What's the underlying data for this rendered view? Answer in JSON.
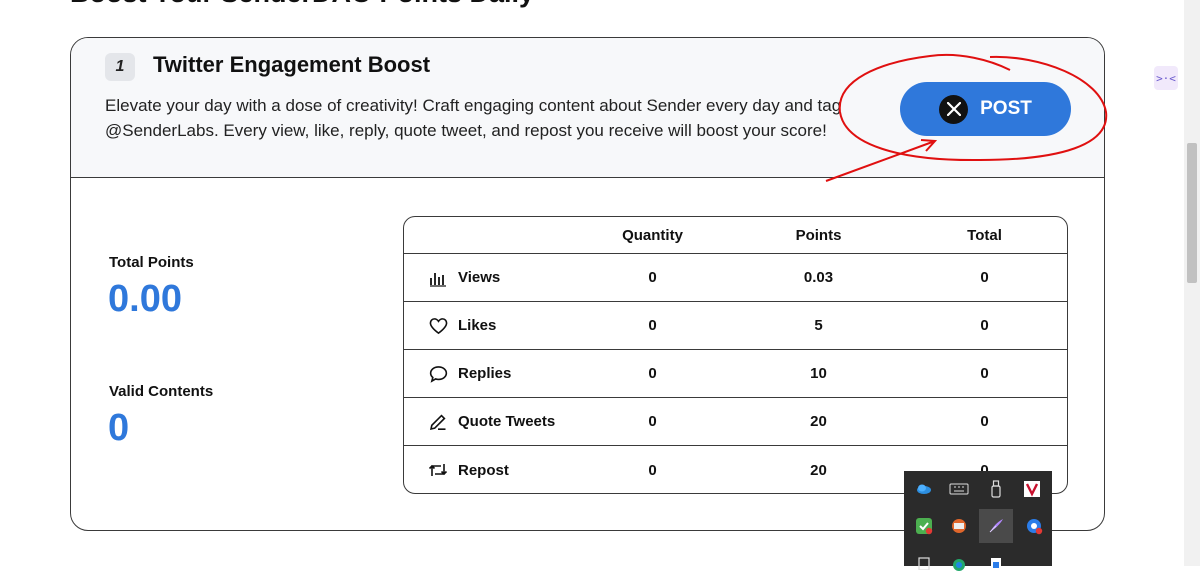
{
  "page": {
    "heading": "Boost Your SenderDAO Points Daily"
  },
  "task": {
    "step_number": "1",
    "title": "Twitter Engagement Boost",
    "description": "Elevate your day with a dose of creativity! Craft engaging content about Sender every day and tag @SenderLabs. Every view, like, reply, quote tweet, and repost you receive will boost your score!",
    "post_button_label": "POST"
  },
  "stats": {
    "total_points_label": "Total Points",
    "total_points_value": "0.00",
    "valid_contents_label": "Valid Contents",
    "valid_contents_value": "0"
  },
  "table": {
    "headers": [
      "Quantity",
      "Points",
      "Total"
    ],
    "rows": [
      {
        "icon": "bar-chart-icon",
        "name": "Views",
        "quantity": "0",
        "points": "0.03",
        "total": "0"
      },
      {
        "icon": "heart-icon",
        "name": "Likes",
        "quantity": "0",
        "points": "5",
        "total": "0"
      },
      {
        "icon": "comment-icon",
        "name": "Replies",
        "quantity": "0",
        "points": "10",
        "total": "0"
      },
      {
        "icon": "pencil-icon",
        "name": "Quote Tweets",
        "quantity": "0",
        "points": "20",
        "total": "0"
      },
      {
        "icon": "repost-icon",
        "name": "Repost",
        "quantity": "0",
        "points": "20",
        "total": "0"
      }
    ]
  },
  "colors": {
    "accent": "#2f78db",
    "annotation": "#e01010",
    "tray_bg": "#2b2b2b"
  }
}
